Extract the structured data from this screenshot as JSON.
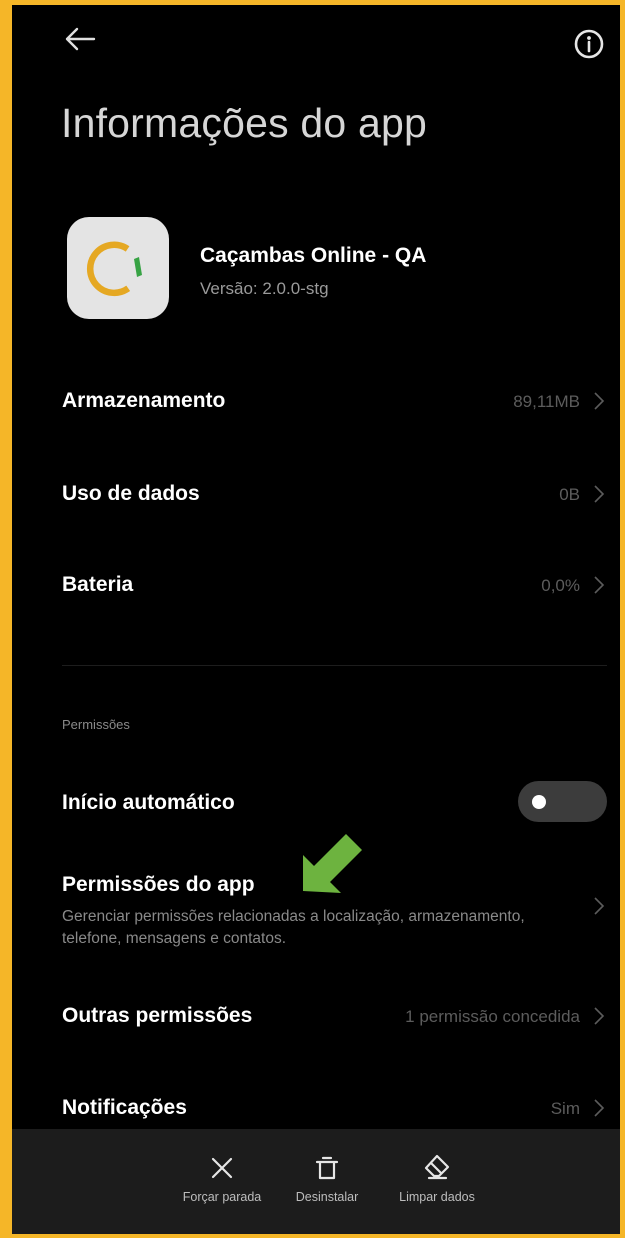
{
  "header": {
    "title": "Informações do app",
    "back_icon": "arrow-left-icon",
    "info_icon": "info-circle-icon"
  },
  "app": {
    "name": "Caçambas Online - QA",
    "version": "Versão: 2.0.0-stg",
    "icon": "app-logo-icon"
  },
  "details": {
    "storage": {
      "label": "Armazenamento",
      "value": "89,11MB"
    },
    "data_usage": {
      "label": "Uso de dados",
      "value": "0B"
    },
    "battery": {
      "label": "Bateria",
      "value": "0,0%"
    }
  },
  "permissions": {
    "section_title": "Permissões",
    "autostart": {
      "label": "Início automático",
      "enabled": false
    },
    "app_permissions": {
      "label": "Permissões do app",
      "description": "Gerenciar permissões relacionadas a localização, armazenamento, telefone, mensagens e contatos."
    },
    "other": {
      "label": "Outras permissões",
      "value": "1 permissão concedida"
    },
    "notifications": {
      "label": "Notificações",
      "value": "Sim"
    }
  },
  "bottom_bar": {
    "force_stop": "Forçar parada",
    "uninstall": "Desinstalar",
    "clear_data": "Limpar dados"
  },
  "colors": {
    "frame_border": "#F5B628",
    "background": "#000000",
    "annotation_arrow": "#6DB33F",
    "logo_orange": "#E5A823",
    "logo_green": "#37A344"
  }
}
